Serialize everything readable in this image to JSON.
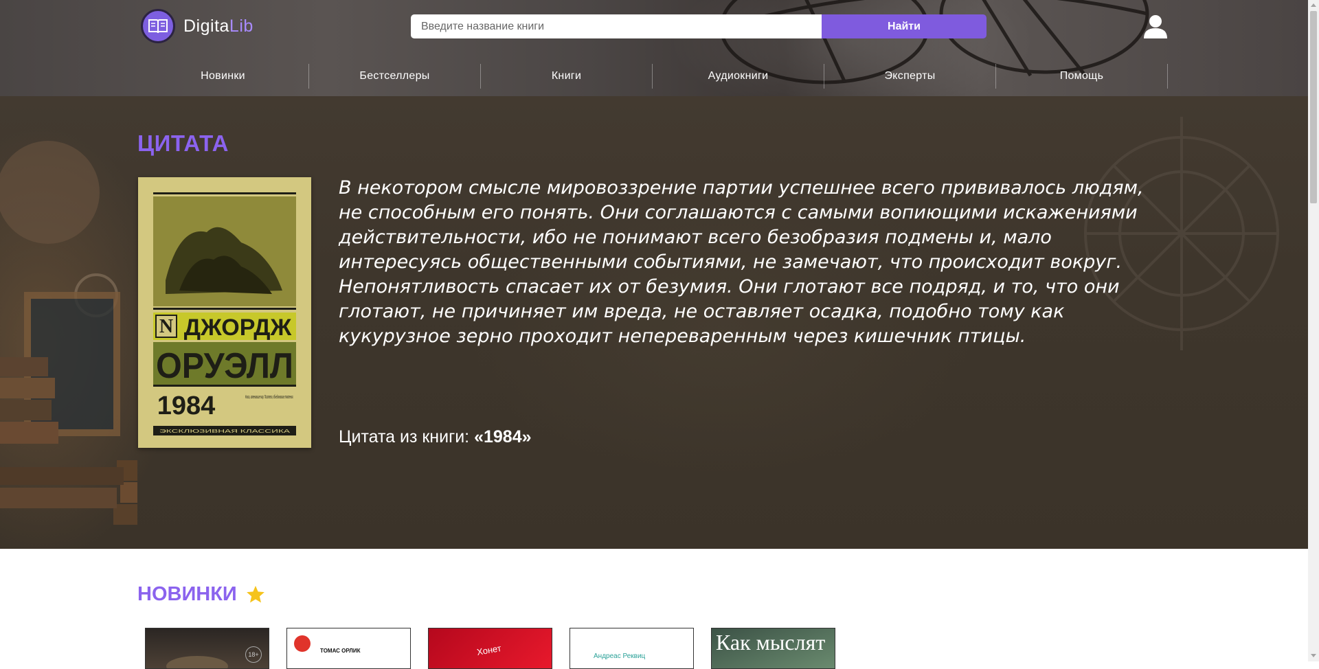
{
  "header": {
    "logo": {
      "first": "Digita",
      "second": "Lib"
    },
    "search": {
      "placeholder": "Введите название книги",
      "button_label": "Найти"
    },
    "nav": [
      {
        "label": "Новинки"
      },
      {
        "label": "Бестселлеры"
      },
      {
        "label": "Книги"
      },
      {
        "label": "Аудиокниги"
      },
      {
        "label": "Эксперты"
      },
      {
        "label": "Помощь"
      }
    ]
  },
  "quote_section": {
    "title": "ЦИТАТА",
    "cover": {
      "author_first": "ДЖОРДЖ",
      "author_last": "ОРУЭЛЛ",
      "title": "1984",
      "note": "Книги, изменившие мир. Писатели, объединившие поколения.",
      "series": "ЭКСКЛЮЗИВНАЯ КЛАССИКА"
    },
    "text": "В некотором смысле мировоззрение партии успешнее всего прививалось людям, не способным его понять. Они соглашаются с самыми вопиющими искажениями действительности, ибо не понимают всего безобразия подмены и, мало интересуясь общественными событиями, не замечают, что происходит вокруг. Непонятливость спасает их от безумия. Они глотают все подряд, и то, что они глотают, не причиняет им вреда, не оставляет осадка, подобно тому как кукурузное зерно проходит непереваренным через кишечник птицы.",
    "source_prefix": "Цитата из книги:",
    "source_book": "«1984»"
  },
  "new_section": {
    "title": "НОВИНКИ",
    "cards": [
      {
        "text": "18+"
      },
      {
        "text": "ТОМАС ОРЛИК"
      },
      {
        "text": "Хонет"
      },
      {
        "text": "Андреас Реквиц"
      },
      {
        "text": "Как мыслят"
      }
    ]
  },
  "colors": {
    "accent": "#8b63ee",
    "button": "#7f5bde"
  },
  "icons": {
    "user": "user-icon",
    "star": "star-icon",
    "logo": "book-icon"
  }
}
